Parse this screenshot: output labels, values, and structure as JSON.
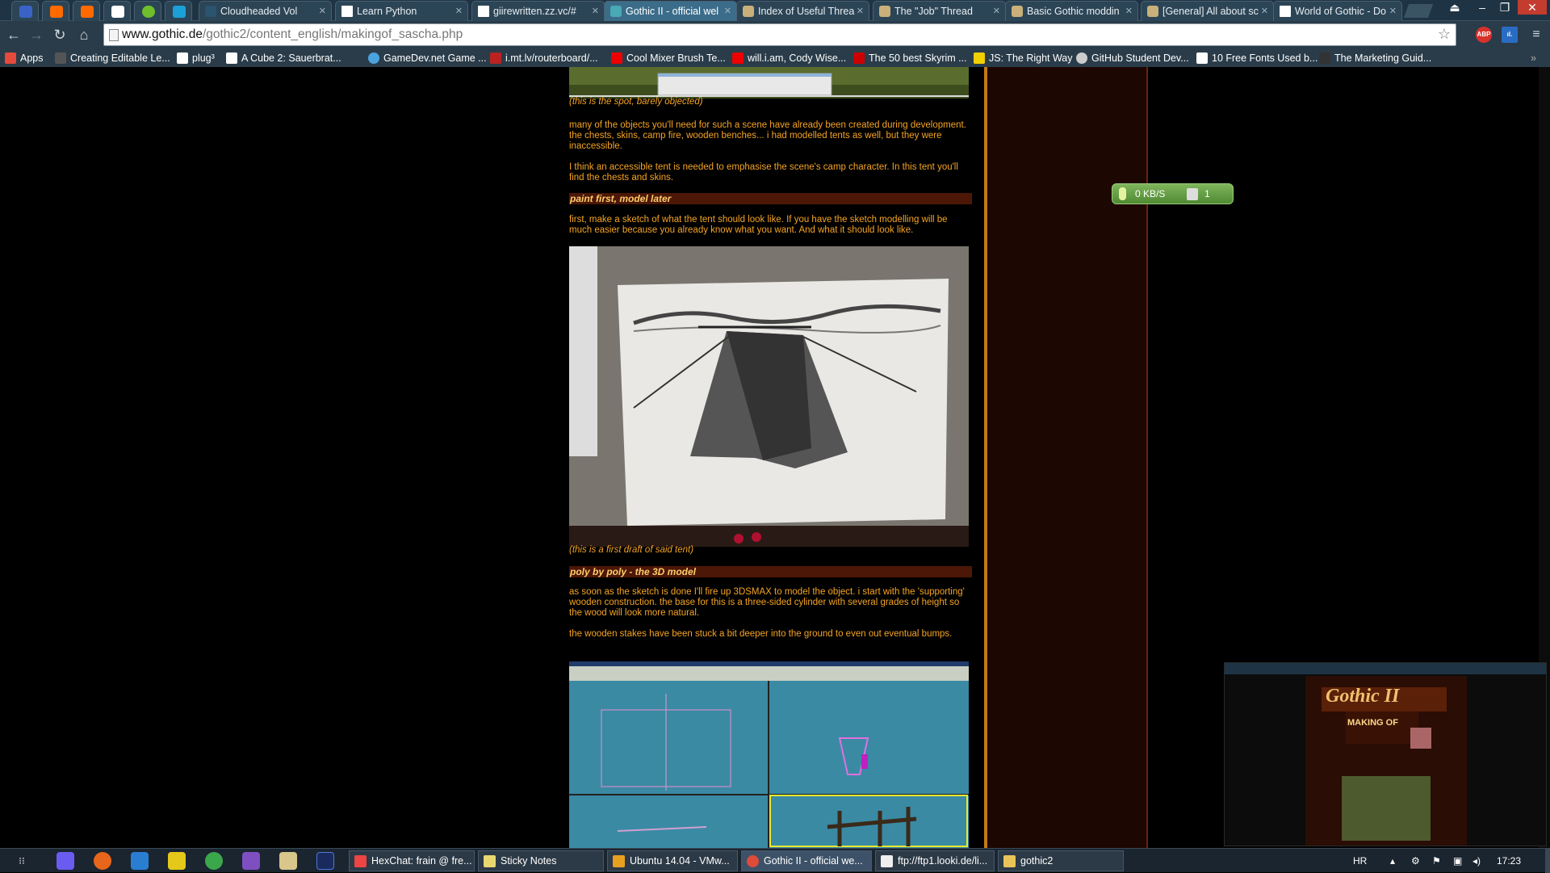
{
  "browser": {
    "tabs": [
      {
        "title": "Cloudheaded Vol"
      },
      {
        "title": "Learn Python"
      },
      {
        "title": "giirewritten.zz.vc/#"
      },
      {
        "title": "Gothic II - official wel",
        "active": true
      },
      {
        "title": "Index of Useful Threa"
      },
      {
        "title": "The \"Job\" Thread"
      },
      {
        "title": "Basic Gothic moddin"
      },
      {
        "title": "[General] All about sc"
      },
      {
        "title": "World of Gothic - Do"
      }
    ],
    "url_host": "www.gothic.de",
    "url_path": "/gothic2/content_english/makingof_sascha.php",
    "extensions": [
      "ABP"
    ],
    "bookmarks": [
      "Apps",
      "Creating Editable Le...",
      "plug³",
      "A Cube 2: Sauerbrat...",
      "GameDev.net Game ...",
      "i.mt.lv/routerboard/...",
      "Cool Mixer Brush Te...",
      "will.i.am, Cody Wise...",
      "The 50 best Skyrim ...",
      "JS: The Right Way",
      "GitHub Student Dev...",
      "10 Free Fonts Used b...",
      "The Marketing Guid..."
    ]
  },
  "article": {
    "caption_spot": "(this is the spot, barely objected)",
    "para_objects": "many of the objects you'll need for such a scene have already been created during development. the chests, skins, camp fire, wooden benches... i had modelled tents as well, but they were inaccessible.",
    "para_tent": "I think an accessible tent is needed to emphasise the scene's camp character. In this tent you'll find the chests and skins.",
    "heading_paint": "paint first, model later",
    "para_sketch": "first, make a sketch of what the tent should look like. If you have the sketch modelling will be much easier because you already know what you want. And what it should look like.",
    "caption_draft": "(this is a first draft of said tent)",
    "heading_poly": "poly by poly - the 3D model",
    "para_3dsmax": "as soon as the sketch is done I'll fire up 3DSMAX to model the object. i start with the 'supporting' wooden construction. the base for this is a three-sided cylinder with several grades of height so the wood will look more natural.",
    "para_stakes": "the wooden stakes have been stuck a bit deeper into the ground to even out eventual bumps."
  },
  "download_widget": {
    "speed": "0 KB/S",
    "count": "1"
  },
  "preview": {
    "logo": "Gothic II",
    "subtitle": "MAKING OF"
  },
  "taskbar": {
    "tasks": [
      {
        "label": "HexChat: frain @ fre..."
      },
      {
        "label": "Sticky Notes"
      },
      {
        "label": "Ubuntu 14.04 - VMw..."
      },
      {
        "label": "Gothic II - official we...",
        "active": true
      },
      {
        "label": "ftp://ftp1.looki.de/li..."
      },
      {
        "label": "gothic2"
      }
    ],
    "language": "HR",
    "time": "17:23"
  }
}
